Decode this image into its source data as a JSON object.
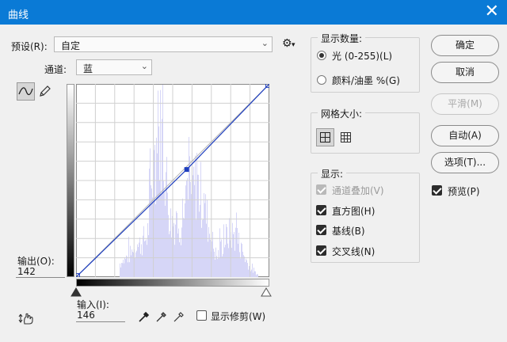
{
  "window": {
    "title": "曲线",
    "close_glyph": "✕"
  },
  "preset": {
    "label": "预设(R):",
    "value": "自定",
    "gear_glyph": "⚙",
    "menu_glyph": "▾"
  },
  "channel": {
    "label": "通道:",
    "value": "蓝"
  },
  "output": {
    "label": "输出(O):",
    "value": "142"
  },
  "input": {
    "label": "输入(I):",
    "value": "146"
  },
  "show_clipping": {
    "label": "显示修剪(W)",
    "checked": false
  },
  "show_amount": {
    "title": "显示数量:",
    "options": [
      {
        "label": "光 (0-255)(L)",
        "selected": true
      },
      {
        "label": "颜料/油墨 %(G)",
        "selected": false
      }
    ]
  },
  "grid_size": {
    "title": "网格大小:"
  },
  "display": {
    "title": "显示:",
    "options": [
      {
        "label": "通道叠加(V)",
        "checked": true,
        "disabled": true
      },
      {
        "label": "直方图(H)",
        "checked": true,
        "disabled": false
      },
      {
        "label": "基线(B)",
        "checked": true,
        "disabled": false
      },
      {
        "label": "交叉线(N)",
        "checked": true,
        "disabled": false
      }
    ]
  },
  "buttons": {
    "ok": "确定",
    "cancel": "取消",
    "smooth": "平滑(M)",
    "auto": "自动(A)",
    "options": "选项(T)..."
  },
  "preview": {
    "label": "预览(P)",
    "checked": true
  },
  "colors": {
    "accent": "#0a7ad6",
    "curve": "#1f3fbf",
    "histogram": "#d6d6f7"
  }
}
